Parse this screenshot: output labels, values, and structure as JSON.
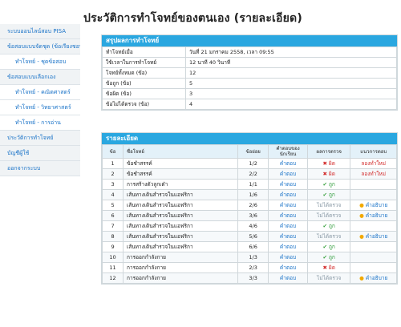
{
  "sidebar": {
    "items": [
      {
        "label": "ระบบออนไลน์สอบ PISA",
        "type": "grp"
      },
      {
        "label": "ข้อสอบแบบจัดชุด (ข้อเรียงชอบ)",
        "type": "grp"
      },
      {
        "label": "ทำโจทย์ - ชุดข้อสอบ",
        "type": "sub"
      },
      {
        "label": "ข้อสอบแบบเลือกเอง",
        "type": "grp"
      },
      {
        "label": "ทำโจทย์ - คณิตศาสตร์",
        "type": "sub"
      },
      {
        "label": "ทำโจทย์ - วิทยาศาสตร์",
        "type": "sub"
      },
      {
        "label": "ทำโจทย์ - การอ่าน",
        "type": "sub"
      },
      {
        "label": "ประวัติการทำโจทย์",
        "type": "grp"
      },
      {
        "label": "บัญชีผู้ใช้",
        "type": "grp"
      },
      {
        "label": "ออกจากระบบ",
        "type": "grp"
      }
    ]
  },
  "page_title": "ประวัติการทำโจทย์ของตนเอง (รายละเอียด)",
  "summary": {
    "title": "สรุปผลการทำโจทย์",
    "rows": [
      {
        "k": "ทำโจทย์เมื่อ",
        "v": "วันที่ 21 มกราคม 2558, เวลา 09:55"
      },
      {
        "k": "ใช้เวลาในการทำโจทย์",
        "v": "12 นาที 40 วินาที"
      },
      {
        "k": "โจทย์ทั้งหมด (ข้อ)",
        "v": "12"
      },
      {
        "k": "ข้อถูก (ข้อ)",
        "v": "5"
      },
      {
        "k": "ข้อผิด (ข้อ)",
        "v": "3"
      },
      {
        "k": "ข้อไม่ได้ตรวจ (ข้อ)",
        "v": "4"
      }
    ]
  },
  "details": {
    "title": "รายละเอียด",
    "headers": {
      "no": "ข้อ",
      "name": "ชื่อโจทย์",
      "sub": "ข้อย่อย",
      "ans": "คำตอบของนักเรียน",
      "result": "ผลการตรวจ",
      "guide": "แนวการตอบ"
    },
    "rows": [
      {
        "no": "1",
        "name": "ข้อชำสรรค์",
        "sub": "1/2",
        "ans": "คำตอบ",
        "result": "ผิด",
        "status": "wrong",
        "guide": "ลองทำใหม่",
        "guide_type": "redo"
      },
      {
        "no": "2",
        "name": "ข้อชำสรรค์",
        "sub": "2/2",
        "ans": "คำตอบ",
        "result": "ผิด",
        "status": "wrong",
        "guide": "ลองทำใหม่",
        "guide_type": "redo"
      },
      {
        "no": "3",
        "name": "การสร้างตัวลูกเต๋า",
        "sub": "1/1",
        "ans": "คำตอบ",
        "result": "ถูก",
        "status": "right",
        "guide": "",
        "guide_type": ""
      },
      {
        "no": "4",
        "name": "เส้นทางเดินสำรวจในแอฟริกา",
        "sub": "1/6",
        "ans": "คำตอบ",
        "result": "ถูก",
        "status": "right",
        "guide": "",
        "guide_type": ""
      },
      {
        "no": "5",
        "name": "เส้นทางเดินสำรวจในแอฟริกา",
        "sub": "2/6",
        "ans": "คำตอบ",
        "result": "ไม่ได้ตรวจ",
        "status": "unchecked",
        "guide": "คำอธิบาย",
        "guide_type": "explain"
      },
      {
        "no": "6",
        "name": "เส้นทางเดินสำรวจในแอฟริกา",
        "sub": "3/6",
        "ans": "คำตอบ",
        "result": "ไม่ได้ตรวจ",
        "status": "unchecked",
        "guide": "คำอธิบาย",
        "guide_type": "explain"
      },
      {
        "no": "7",
        "name": "เส้นทางเดินสำรวจในแอฟริกา",
        "sub": "4/6",
        "ans": "คำตอบ",
        "result": "ถูก",
        "status": "right",
        "guide": "",
        "guide_type": ""
      },
      {
        "no": "8",
        "name": "เส้นทางเดินสำรวจในแอฟริกา",
        "sub": "5/6",
        "ans": "คำตอบ",
        "result": "ไม่ได้ตรวจ",
        "status": "unchecked",
        "guide": "คำอธิบาย",
        "guide_type": "explain"
      },
      {
        "no": "9",
        "name": "เส้นทางเดินสำรวจในแอฟริกา",
        "sub": "6/6",
        "ans": "คำตอบ",
        "result": "ถูก",
        "status": "right",
        "guide": "",
        "guide_type": ""
      },
      {
        "no": "10",
        "name": "การออกกำลังกาย",
        "sub": "1/3",
        "ans": "คำตอบ",
        "result": "ถูก",
        "status": "right",
        "guide": "",
        "guide_type": ""
      },
      {
        "no": "11",
        "name": "การออกกำลังกาย",
        "sub": "2/3",
        "ans": "คำตอบ",
        "result": "ผิด",
        "status": "wrong",
        "guide": "",
        "guide_type": ""
      },
      {
        "no": "12",
        "name": "การออกกำลังกาย",
        "sub": "3/3",
        "ans": "คำตอบ",
        "result": "ไม่ได้ตรวจ",
        "status": "unchecked",
        "guide": "คำอธิบาย",
        "guide_type": "explain"
      }
    ]
  }
}
